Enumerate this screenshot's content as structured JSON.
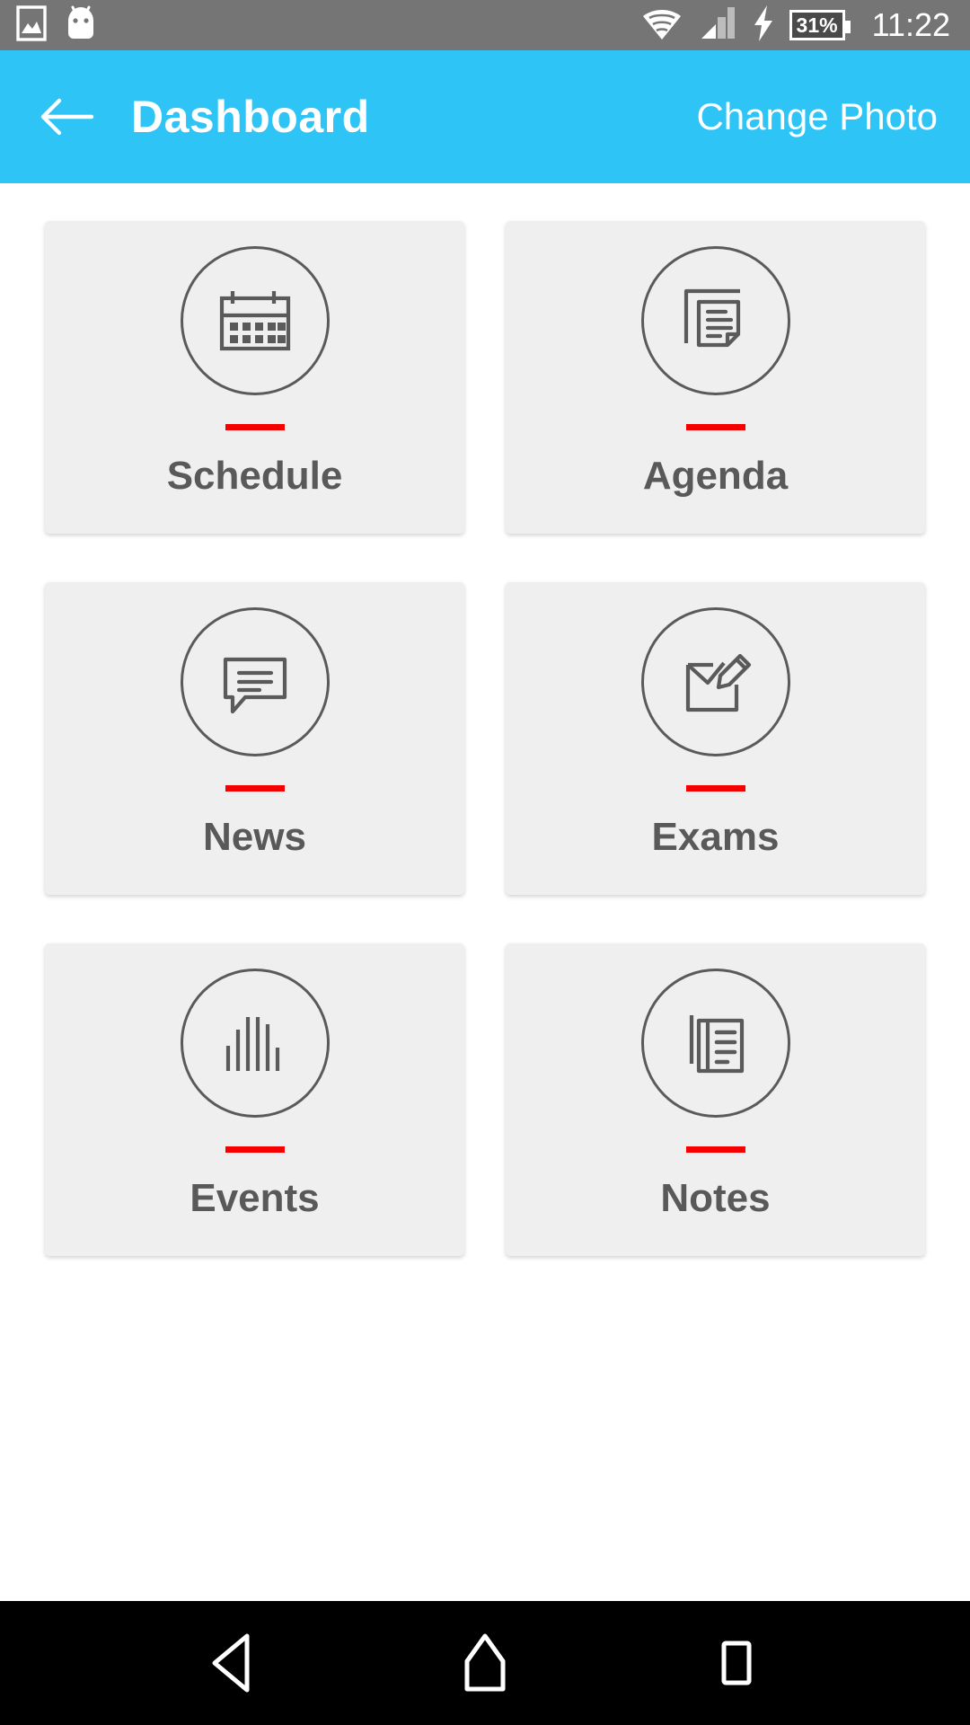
{
  "status_bar": {
    "background_color": "#757575",
    "left_icons": [
      {
        "name": "image-icon",
        "glyph": "picture"
      },
      {
        "name": "android-bugdroid-icon",
        "glyph": "bugdroid"
      }
    ],
    "right_icons": [
      {
        "name": "wifi-icon",
        "glyph": "wifi"
      },
      {
        "name": "cellular-signal-icon",
        "glyph": "signal"
      },
      {
        "name": "charging-bolt-icon",
        "glyph": "bolt"
      }
    ],
    "battery_percent": "31%",
    "clock": "11:22"
  },
  "app_bar": {
    "background_color": "#2ec5f6",
    "back_icon": "arrow-left-icon",
    "title": "Dashboard",
    "action_label": "Change Photo"
  },
  "theme": {
    "tile_background": "#efefef",
    "rule_color": "#f40000",
    "icon_stroke": "#5a5a5a",
    "label_color": "#595959",
    "page_background": "#ffffff",
    "nav_background": "#000000"
  },
  "tiles": [
    {
      "id": "schedule",
      "label": "Schedule",
      "icon": "calendar-icon"
    },
    {
      "id": "agenda",
      "label": "Agenda",
      "icon": "documents-icon"
    },
    {
      "id": "news",
      "label": "News",
      "icon": "speech-bubble-icon"
    },
    {
      "id": "exams",
      "label": "Exams",
      "icon": "document-pencil-icon"
    },
    {
      "id": "events",
      "label": "Events",
      "icon": "bar-chart-icon"
    },
    {
      "id": "notes",
      "label": "Notes",
      "icon": "notepad-icon"
    }
  ],
  "nav_bar": {
    "buttons": [
      {
        "name": "nav-back-button",
        "icon": "triangle-back-icon"
      },
      {
        "name": "nav-home-button",
        "icon": "home-pentagon-icon"
      },
      {
        "name": "nav-recents-button",
        "icon": "square-recents-icon"
      }
    ]
  }
}
